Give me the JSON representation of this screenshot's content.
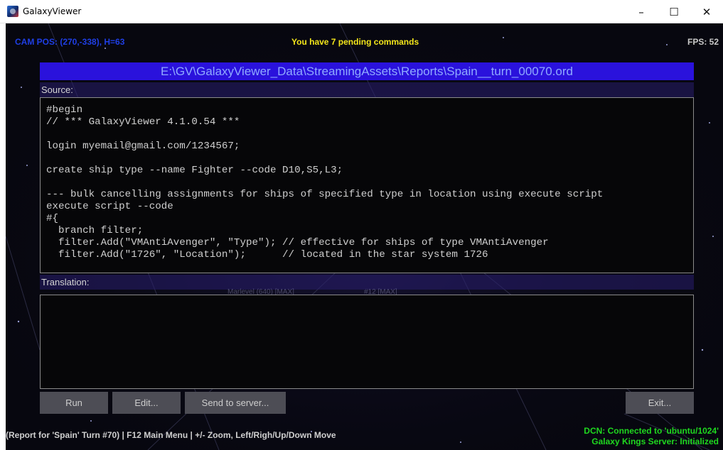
{
  "window": {
    "title": "GalaxyViewer",
    "minimize_glyph": "–",
    "maximize_glyph": "☐",
    "close_glyph": "✕"
  },
  "hud": {
    "cam_pos": "CAM POS: (270,-338), H=63",
    "pending": "You have 7 pending commands",
    "fps": "FPS: 52"
  },
  "report": {
    "file_path": "E:\\GV\\GalaxyViewer_Data\\StreamingAssets\\Reports\\Spain__turn_00070.ord",
    "source_label": "Source:",
    "translation_label": "Translation:",
    "source_lines": [
      "#begin",
      "// *** GalaxyViewer 4.1.0.54 ***",
      "",
      "login myemail@gmail.com/1234567;",
      "",
      "create ship type --name Fighter --code D10,S5,L3;",
      "",
      "--- bulk cancelling assignments for ships of specified type in location using execute script",
      "execute script --code",
      "#{",
      "  branch filter;",
      "  filter.Add(\"VMAntiAvenger\", \"Type\"); // effective for ships of type VMAntiAvenger",
      "  filter.Add(\"1726\", \"Location\");      // located in the star system 1726"
    ],
    "translation_text": ""
  },
  "buttons": {
    "run": "Run",
    "edit": "Edit...",
    "send": "Send to server...",
    "exit": "Exit..."
  },
  "map_labels": {
    "left": "Marlevel (640) [MAX]",
    "right": "#12 [MAX]"
  },
  "status": {
    "left": "(Report for 'Spain' Turn #70) | F12 Main Menu | +/- Zoom, Left/Righ/Up/Down Move",
    "dcn": "DCN: Connected to 'ubuntu/1024'",
    "server": "Galaxy Kings Server: Initialized"
  },
  "colors": {
    "cam_pos": "#1f3fe6",
    "pending": "#f4e61a",
    "path_bar": "#2a12dc",
    "status_ok": "#1fd81f"
  }
}
